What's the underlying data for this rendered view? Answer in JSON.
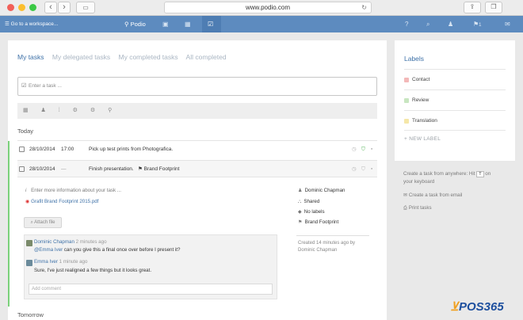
{
  "browser": {
    "url": "www.podio.com",
    "back_icon": "chevron-left-icon",
    "forward_icon": "chevron-right-icon"
  },
  "appbar": {
    "workspace_menu": "Go to a workspace...",
    "brand": "Podio",
    "menu_glyph": "☰",
    "brand_glyph": "⚲",
    "apps_glyph": "▣",
    "cal_glyph": "▦",
    "tasks_glyph": "☑",
    "help_glyph": "?",
    "search_glyph": "⌕",
    "contacts_glyph": "♟",
    "notif_glyph": "⚑",
    "notif_count": "1",
    "chat_glyph": "✉"
  },
  "tabs": [
    "My tasks",
    "My delegated tasks",
    "My completed tasks",
    "All completed"
  ],
  "task_input": {
    "placeholder": "Enter a task ..."
  },
  "toolbar_glyphs": "▦ ♟ ⁞ ⚙ ⚙ ⚲",
  "sections": {
    "today": "Today",
    "tomorrow": "Tomorrow"
  },
  "tasks": [
    {
      "date": "28/10/2014",
      "time": "17:00",
      "title": "Pick up test prints from Photografica.",
      "ref": ""
    },
    {
      "date": "28/10/2014",
      "time": "—",
      "title": "Finish presentation.",
      "ref": "Brand Footprint"
    }
  ],
  "detail": {
    "info_placeholder": "Enter more information about your task ...",
    "info_glyph": "i",
    "file": "Grafit Brand Footprint 2015.pdf",
    "attach_label": "Attach file",
    "assignee": "Dominic Chapman",
    "visibility": "Shared",
    "labels": "No labels",
    "reference": "Brand Footprint",
    "created": "Created 14 minutes ago by Dominic Chapman"
  },
  "comments": [
    {
      "author": "Dominic Chapman",
      "time": "2 minutes ago",
      "mention": "@Emma Iver",
      "text": " can you give this a final once over before I present it?"
    },
    {
      "author": "Emma Iver",
      "time": "1 minute ago",
      "mention": "",
      "text": "Sure, I've just realigned a few things but it looks great."
    }
  ],
  "add_comment_placeholder": "Add comment",
  "sidebar": {
    "title": "Labels",
    "labels": [
      {
        "name": "Contact",
        "color": "#f3b8b8"
      },
      {
        "name": "Review",
        "color": "#c8e6c0"
      },
      {
        "name": "Translation",
        "color": "#f5e7a8"
      }
    ],
    "new_label": "+ NEW LABEL"
  },
  "hints": {
    "create_anywhere_pre": "Create a task from anywhere: Hit",
    "key": "T",
    "create_anywhere_post": "on",
    "keyboard": "your keyboard",
    "from_email": "Create a task from email",
    "print": "Print tasks"
  },
  "watermark": "POS365",
  "colors": {
    "appbar": "#5d8bbf",
    "link": "#3f72a8",
    "green": "#7ad17a"
  }
}
